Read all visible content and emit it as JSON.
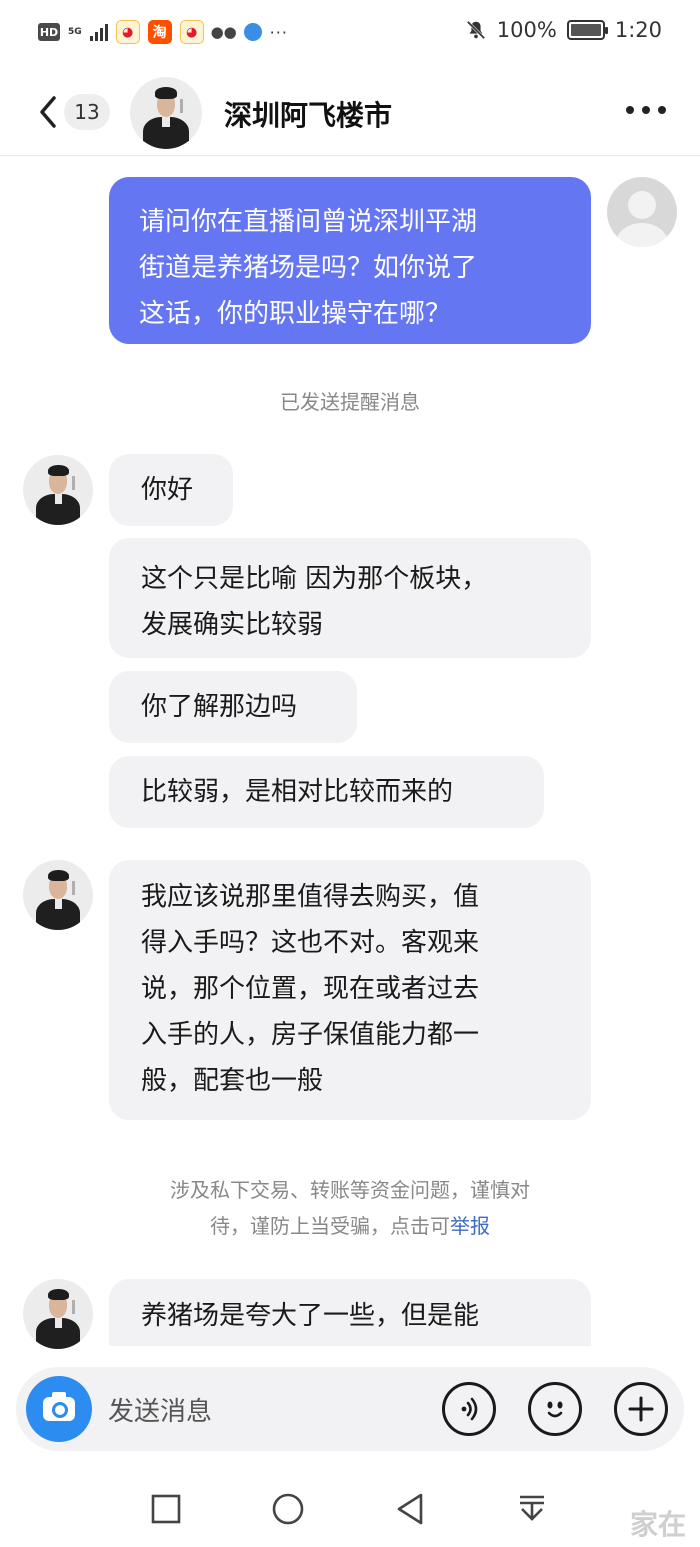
{
  "status_bar": {
    "hd": "HD",
    "network": "5G",
    "battery": "100%",
    "time": "1:20",
    "more": "···",
    "apps": [
      "weibo",
      "taobao",
      "weibo",
      "wechat",
      "browser"
    ]
  },
  "header": {
    "unread_count": "13",
    "title": "深圳阿飞楼市"
  },
  "messages": {
    "sent_1_lines": [
      "请问你在直播间曾说深圳平湖",
      "街道是养猪场是吗？如你说了",
      "这话，你的职业操守在哪？"
    ],
    "system_notice": "已发送提醒消息",
    "reply_1": "你好",
    "reply_2_lines": [
      "这个只是比喻 因为那个板块，",
      "发展确实比较弱"
    ],
    "reply_3": "你了解那边吗",
    "reply_4": "比较弱，是相对比较而来的",
    "reply_5_lines": [
      "我应该说那里值得去购买，值",
      "得入手吗？这也不对。客观来",
      "说，那个位置，现在或者过去",
      "入手的人，房子保值能力都一",
      "般，配套也一般"
    ],
    "warning_line1": "涉及私下交易、转账等资金问题，谨慎对",
    "warning_line2": "待，谨防上当受骗，点击可",
    "warning_link": "举报",
    "reply_6": "养猪场是夸大了一些，但是能"
  },
  "input": {
    "placeholder": "发送消息"
  },
  "colors": {
    "sent_bubble": "#6576f3",
    "received_bubble": "#f2f2f4",
    "camera_button": "#2d8cf0",
    "link": "#3e6bc4"
  },
  "watermark": "家在"
}
